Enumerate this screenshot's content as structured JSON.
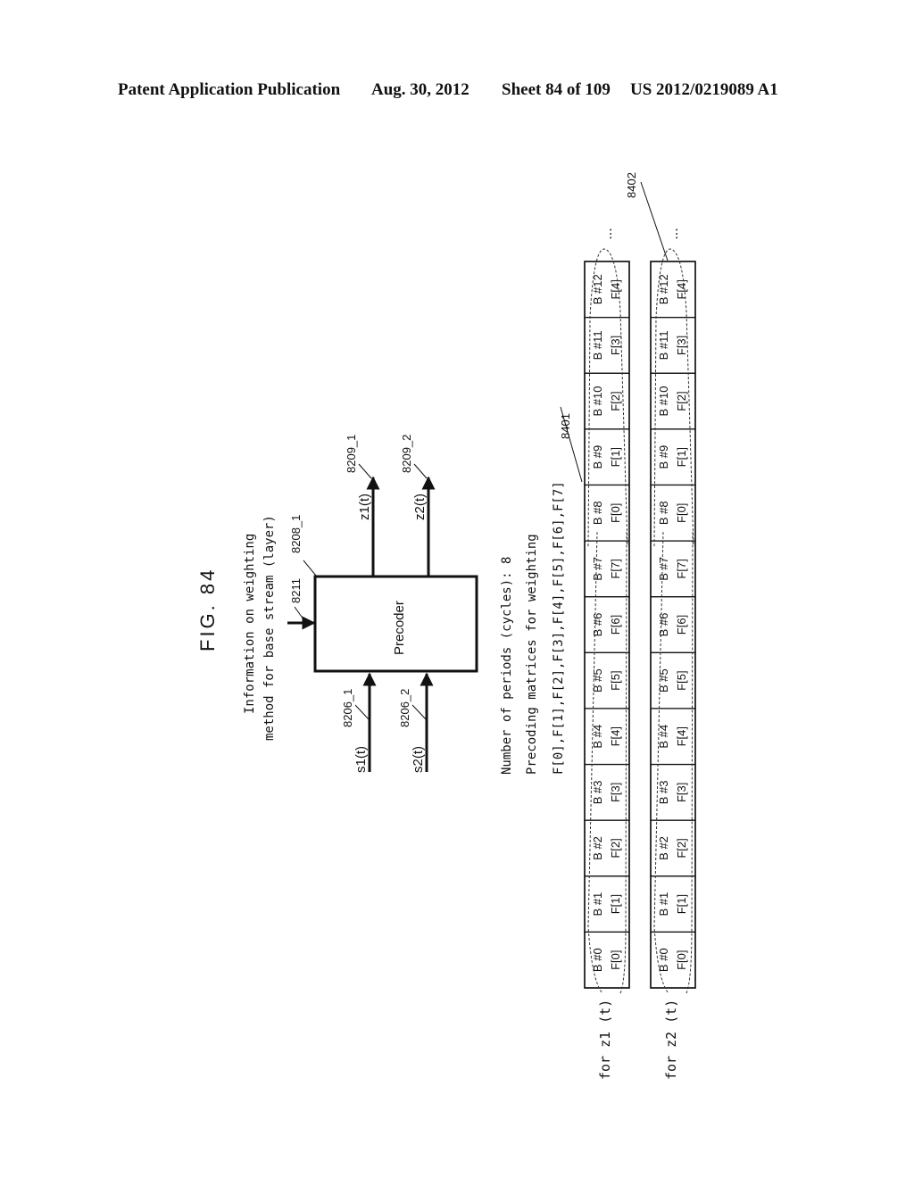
{
  "header": {
    "left": "Patent Application Publication",
    "date": "Aug. 30, 2012",
    "sheet": "Sheet 84 of 109",
    "number": "US 2012/0219089 A1"
  },
  "figure": {
    "title": "FIG. 84",
    "weighting_info_line1": "Information on weighting",
    "weighting_info_line2": "method for base stream (layer)",
    "precoder_label": "Precoder",
    "refs": {
      "weighting_info": "8211",
      "precoder": "8208_1",
      "s1": "8206_1",
      "s2": "8206_2",
      "z1": "8209_1",
      "z2": "8209_2",
      "group_z1": "8401",
      "group_z2": "8402"
    },
    "signals": {
      "s1": "s1(t)",
      "s2": "s2(t)",
      "z1": "z1(t)",
      "z2": "z2(t)"
    },
    "notes": [
      "Number of periods (cycles): 8",
      "Precoding matrices for weighting",
      "F[0],F[1],F[2],F[3],F[4],F[5],F[6],F[7]"
    ],
    "rows": [
      {
        "label": "for z1 (t)",
        "ellipsis": "..."
      },
      {
        "label": "for z2 (t)",
        "ellipsis": "..."
      }
    ],
    "cells": [
      {
        "b": "B #0",
        "f": "F[0]"
      },
      {
        "b": "B #1",
        "f": "F[1]"
      },
      {
        "b": "B #2",
        "f": "F[2]"
      },
      {
        "b": "B #3",
        "f": "F[3]"
      },
      {
        "b": "B #4",
        "f": "F[4]"
      },
      {
        "b": "B #5",
        "f": "F[5]"
      },
      {
        "b": "B #6",
        "f": "F[6]"
      },
      {
        "b": "B #7",
        "f": "F[7]"
      },
      {
        "b": "B #8",
        "f": "F[0]"
      },
      {
        "b": "B #9",
        "f": "F[1]"
      },
      {
        "b": "B #10",
        "f": "F[2]"
      },
      {
        "b": "B #11",
        "f": "F[3]"
      },
      {
        "b": "B #12",
        "f": "F[4]"
      }
    ]
  }
}
